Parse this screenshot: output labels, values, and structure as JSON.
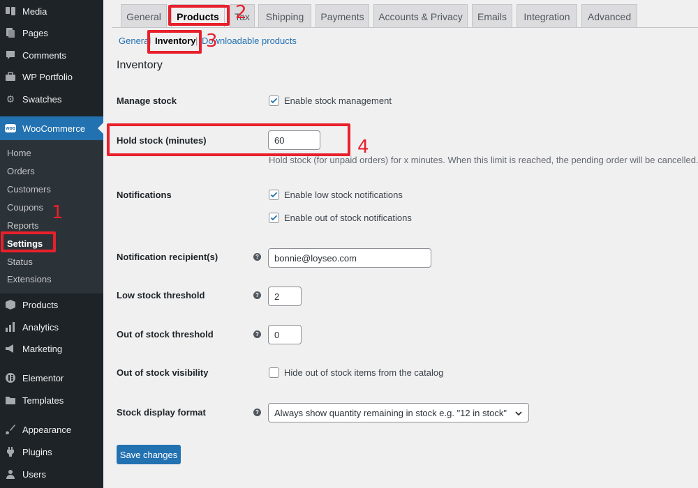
{
  "sidebar": {
    "items": [
      {
        "label": "Media",
        "icon": "media-icon"
      },
      {
        "label": "Pages",
        "icon": "pages-icon"
      },
      {
        "label": "Comments",
        "icon": "comments-icon"
      },
      {
        "label": "WP Portfolio",
        "icon": "portfolio-icon"
      },
      {
        "label": "Swatches",
        "icon": "gear-icon"
      },
      {
        "label": "WooCommerce",
        "icon": "woocommerce-icon",
        "badge": "woo"
      },
      {
        "label": "Products",
        "icon": "box-icon"
      },
      {
        "label": "Analytics",
        "icon": "bar-chart-icon"
      },
      {
        "label": "Marketing",
        "icon": "megaphone-icon"
      },
      {
        "label": "Elementor",
        "icon": "elementor-icon"
      },
      {
        "label": "Templates",
        "icon": "folder-icon"
      },
      {
        "label": "Appearance",
        "icon": "brush-icon"
      },
      {
        "label": "Plugins",
        "icon": "plugin-icon"
      },
      {
        "label": "Users",
        "icon": "users-icon"
      }
    ],
    "submenu": [
      "Home",
      "Orders",
      "Customers",
      "Coupons",
      "Reports",
      "Settings",
      "Status",
      "Extensions"
    ]
  },
  "tabs": [
    "General",
    "Products",
    "Tax",
    "Shipping",
    "Payments",
    "Accounts & Privacy",
    "Emails",
    "Integration",
    "Advanced"
  ],
  "subsections": {
    "general": "General",
    "inventory": "Inventory",
    "downloadable": "Downloadable products",
    "separator": "|"
  },
  "section_title": "Inventory",
  "form": {
    "manage_stock": {
      "label": "Manage stock",
      "checkbox_label": "Enable stock management",
      "checked": true
    },
    "hold_stock": {
      "label": "Hold stock (minutes)",
      "value": "60",
      "description": "Hold stock (for unpaid orders) for x minutes. When this limit is reached, the pending order will be cancelled."
    },
    "notifications": {
      "label": "Notifications",
      "low_label": "Enable low stock notifications",
      "low_checked": true,
      "out_label": "Enable out of stock notifications",
      "out_checked": true
    },
    "recipient": {
      "label": "Notification recipient(s)",
      "value": "bonnie@loyseo.com"
    },
    "low_threshold": {
      "label": "Low stock threshold",
      "value": "2"
    },
    "out_threshold": {
      "label": "Out of stock threshold",
      "value": "0"
    },
    "visibility": {
      "label": "Out of stock visibility",
      "checkbox_label": "Hide out of stock items from the catalog",
      "checked": false
    },
    "display_format": {
      "label": "Stock display format",
      "selected": "Always show quantity remaining in stock e.g. \"12 in stock\""
    }
  },
  "save_button": "Save changes",
  "help_glyph": "?",
  "annotations": {
    "one": "1",
    "two": "2",
    "three": "3",
    "four": "4"
  },
  "colors": {
    "accent": "#2271b1",
    "sidebar": "#1d2327",
    "annotation": "#e8202b"
  }
}
